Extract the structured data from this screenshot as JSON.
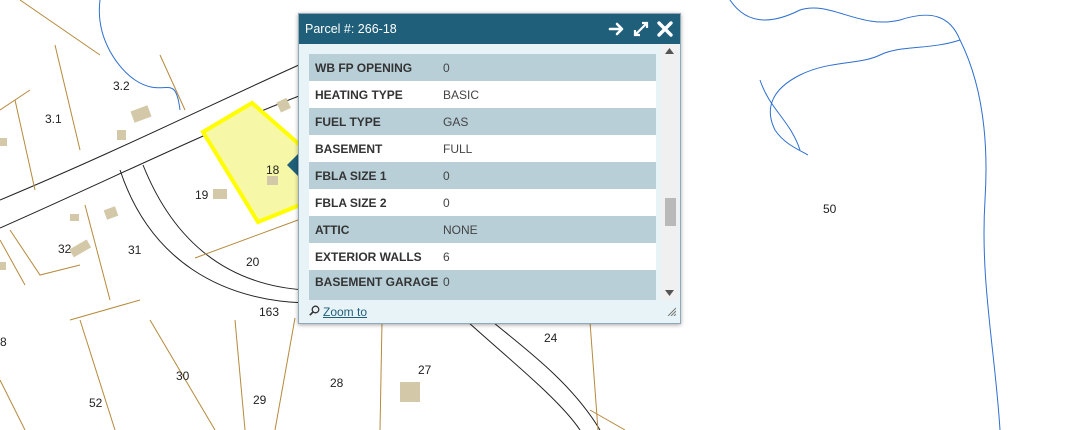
{
  "popup": {
    "title": "Parcel #: 266-18",
    "zoom_label": "Zoom to",
    "icons": {
      "arrow": "arrow-right-icon",
      "maximize": "maximize-icon",
      "close": "close-icon",
      "zoom": "magnifier-icon",
      "resize": "resize-grip-icon"
    },
    "rows": [
      {
        "key": "WB FP OPENING",
        "value": "0"
      },
      {
        "key": "HEATING TYPE",
        "value": "BASIC"
      },
      {
        "key": "FUEL TYPE",
        "value": "GAS"
      },
      {
        "key": "BASEMENT",
        "value": "FULL"
      },
      {
        "key": "FBLA SIZE 1",
        "value": "0"
      },
      {
        "key": "FBLA SIZE 2",
        "value": "0"
      },
      {
        "key": "ATTIC",
        "value": "NONE"
      },
      {
        "key": "EXTERIOR WALLS",
        "value": "6"
      },
      {
        "key": "BASEMENT GARAGE",
        "value": "0"
      }
    ]
  },
  "map": {
    "parcel_labels": [
      "3.2",
      "3.1",
      "18",
      "19",
      "20",
      "32",
      "31",
      "163",
      "50",
      "24",
      "27",
      "28",
      "29",
      "30",
      "52",
      "8"
    ],
    "colors": {
      "parcel_line": "#b58a3c",
      "road_line": "#222222",
      "water_line": "#2e6fd0",
      "selected_fill": "#f7f7a8",
      "selected_outline": "#ffff00",
      "building": "#d3c9a8",
      "header": "#1f5f7a"
    }
  }
}
